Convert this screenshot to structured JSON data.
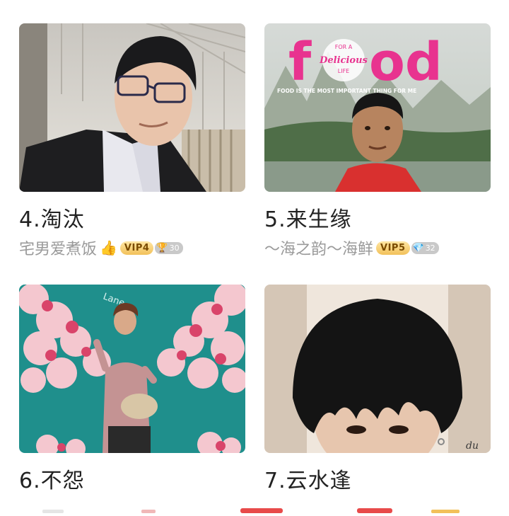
{
  "posts": [
    {
      "title": "4.淘汰",
      "author": "宅男爱煮饭",
      "vip": "VIP4",
      "level": "30",
      "level_icon": "trophy-icon"
    },
    {
      "title": "5.来生缘",
      "author": "～海之韵～海鲜",
      "vip": "VIP5",
      "level": "32",
      "level_icon": "diamond-icon",
      "poster": {
        "f": "f",
        "food_tail": "od",
        "circle_top": "FOR A",
        "circle_mid": "Delicious",
        "circle_bot": "LIFE",
        "tagline": "FOOD IS THE MOST IMPORTANT THING FOR ME"
      }
    },
    {
      "title": "6.不怨",
      "wall_text": "Lane"
    },
    {
      "title": "7.云水逢"
    }
  ],
  "colors": {
    "accent": "#e8338f",
    "vip_gold": "#f2c15a",
    "teal_wall": "#1f8f8c"
  }
}
